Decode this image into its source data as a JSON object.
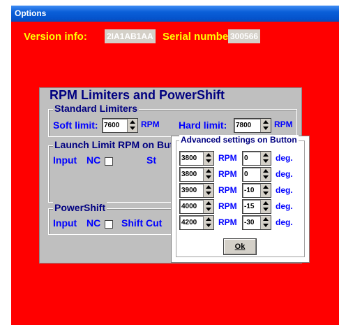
{
  "window": {
    "title": "Options"
  },
  "info": {
    "version_label": "Version info:",
    "version_value": "2IA1AB1AA",
    "serial_label": "Serial number:",
    "serial_value": "300566"
  },
  "panel": {
    "title": "RPM Limiters and PowerShift",
    "standard": {
      "title": "Standard Limiters",
      "soft_label": "Soft limit:",
      "soft_value": "7600",
      "soft_unit": "RPM",
      "hard_label": "Hard limit:",
      "hard_value": "7800",
      "hard_unit": "RPM"
    },
    "launch": {
      "title": "Launch Limit RPM on Button",
      "input_label": "Input",
      "nc_label": "NC",
      "cut_label": "St"
    },
    "powershift": {
      "title": "PowerShift",
      "input_label": "Input",
      "nc_label": "NC",
      "cut_label": "Shift Cut"
    }
  },
  "popup": {
    "title": "Advanced settings on Button",
    "rpm_unit": "RPM",
    "deg_unit": "deg.",
    "rows": [
      {
        "rpm": "3800",
        "deg": "0"
      },
      {
        "rpm": "3800",
        "deg": "0"
      },
      {
        "rpm": "3900",
        "deg": "-10"
      },
      {
        "rpm": "4000",
        "deg": "-15"
      },
      {
        "rpm": "4200",
        "deg": "-30"
      }
    ],
    "ok_label": "Ok"
  }
}
